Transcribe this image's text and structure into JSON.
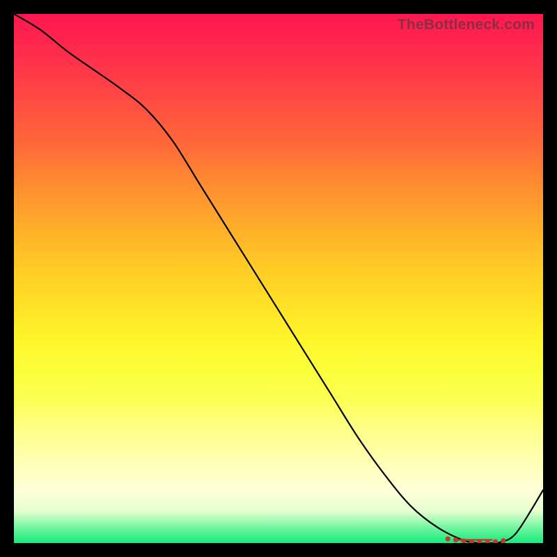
{
  "chart_data": {
    "type": "line",
    "watermark": "TheBottleneck.com",
    "x_range": [
      0,
      100
    ],
    "y_range": [
      0,
      100
    ],
    "gradient_meaning": "bottleneck severity (top=red=bad, bottom=green=good)",
    "series": [
      {
        "name": "bottleneck-curve",
        "stroke": "#000000",
        "x": [
          0,
          5,
          10,
          15,
          20,
          25,
          30,
          35,
          40,
          45,
          50,
          55,
          60,
          65,
          70,
          75,
          80,
          85,
          88,
          90,
          92,
          95,
          100
        ],
        "y": [
          100,
          97,
          93,
          89.5,
          86,
          82,
          76,
          68,
          60,
          52,
          44,
          36,
          28,
          20,
          13,
          7,
          3,
          0.5,
          0,
          0,
          0.2,
          2,
          10
        ]
      }
    ],
    "markers": {
      "color": "#c0392b",
      "radius_px": 3.6,
      "placement_note": "cluster along valley floor ~x 82–92",
      "points": [
        {
          "x": 82,
          "y": 0.8
        },
        {
          "x": 83.5,
          "y": 0.6
        },
        {
          "x": 85,
          "y": 0.4
        },
        {
          "x": 86.5,
          "y": 0.25
        },
        {
          "x": 88,
          "y": 0.15
        },
        {
          "x": 89.5,
          "y": 0.15
        },
        {
          "x": 91,
          "y": 0.25
        },
        {
          "x": 92.5,
          "y": 0.45
        }
      ],
      "bar": {
        "x0": 83,
        "x1": 90.5,
        "y": 0.6,
        "height_frac": 0.003
      }
    }
  }
}
